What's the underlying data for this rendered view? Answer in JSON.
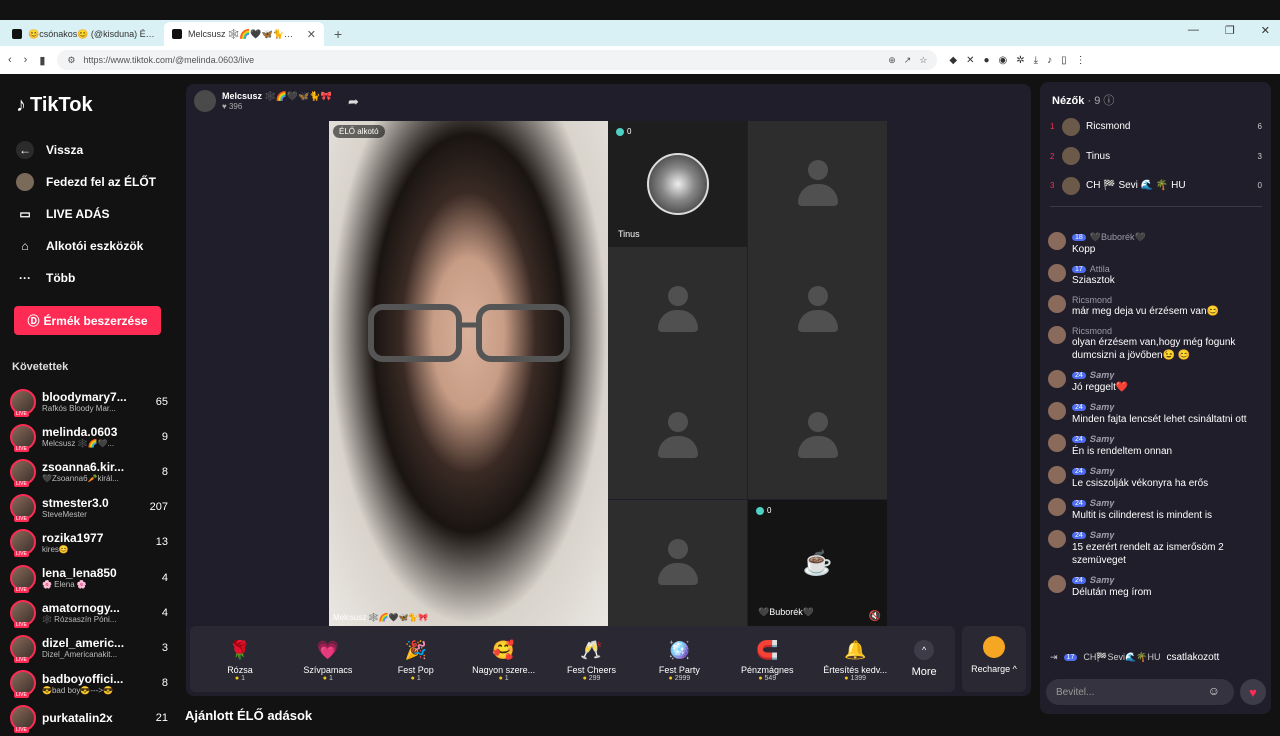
{
  "browser": {
    "tabs": [
      {
        "title": "😊csónakos😊 (@kisduna) ÉLŐ adá",
        "active": false
      },
      {
        "title": "Melcsusz 🕸️🌈🖤🦋🐈🎀 (@",
        "active": true
      }
    ],
    "url": "https://www.tiktok.com/@melinda.0603/live"
  },
  "sidebar": {
    "logo": "TikTok",
    "nav": [
      {
        "label": "Vissza",
        "icon": "back-arrow-icon"
      },
      {
        "label": "Fedezd fel az ÉLŐT",
        "icon": "explore-avatar-icon"
      },
      {
        "label": "LIVE ADÁS",
        "icon": "camera-icon"
      },
      {
        "label": "Alkotói eszközök",
        "icon": "house-icon"
      },
      {
        "label": "Több",
        "icon": "dots-icon"
      }
    ],
    "coin_button": "Érmék beszerzése",
    "following_title": "Követettek",
    "following": [
      {
        "name": "bloodymary7...",
        "sub": "Rafkós Bloody Mar...",
        "count": "65"
      },
      {
        "name": "melinda.0603",
        "sub": "Melcsusz 🕸️🌈🖤...",
        "count": "9"
      },
      {
        "name": "zsoanna6.kir...",
        "sub": "🖤Zsoanna6🥕királ...",
        "count": "8"
      },
      {
        "name": "stmester3.0",
        "sub": "SteveMester",
        "count": "207"
      },
      {
        "name": "rozika1977",
        "sub": "kires😊",
        "count": "13"
      },
      {
        "name": "lena_lena850",
        "sub": "🌸 Elena 🌸",
        "count": "4"
      },
      {
        "name": "amatornogy...",
        "sub": "🕸️ Rózsaszín Póni...",
        "count": "4"
      },
      {
        "name": "dizel_americ...",
        "sub": "Dizel_Americanakit...",
        "count": "3"
      },
      {
        "name": "badboyoffici...",
        "sub": "😎bad boy😎--->😎",
        "count": "8"
      },
      {
        "name": "purkatalin2x",
        "sub": "",
        "count": "21"
      }
    ]
  },
  "live": {
    "host_name": "Melcsusz 🕸️🌈🖤🦋🐈🎀",
    "host_likes": "♥ 396",
    "main_badge": "ÉLŐ alkotó",
    "main_caption": "Melcsusz 🕸️🌈🖤🦋🐈🎀",
    "guest1_name": "Tinus",
    "guest1_count": "0",
    "guest2_name": "🖤Buborék🖤",
    "guest2_count": "0"
  },
  "gifts": [
    {
      "name": "Rózsa",
      "price": "1",
      "icon": "🌹"
    },
    {
      "name": "Szívpamacs",
      "price": "1",
      "icon": "💗"
    },
    {
      "name": "Fest Pop",
      "price": "1",
      "icon": "🎉"
    },
    {
      "name": "Nagyon szere...",
      "price": "1",
      "icon": "🥰"
    },
    {
      "name": "Fest Cheers",
      "price": "299",
      "icon": "🥂"
    },
    {
      "name": "Fest Party",
      "price": "2999",
      "icon": "🪩"
    },
    {
      "name": "Pénzmágnes",
      "price": "549",
      "icon": "🧲"
    },
    {
      "name": "Értesítés kedv...",
      "price": "1399",
      "icon": "🔔"
    }
  ],
  "more_label": "More",
  "recharge_label": "Recharge ^",
  "recommended_title": "Ajánlott ÉLŐ adások",
  "chat": {
    "viewers_title": "Nézők",
    "viewers_count": "· 9",
    "viewers": [
      {
        "rank": "1",
        "name": "Ricsmond",
        "score": "6"
      },
      {
        "rank": "2",
        "name": "Tinus",
        "score": "3"
      },
      {
        "rank": "3",
        "name": "CH 🏁 Sevi 🌊 🌴 HU",
        "score": "0"
      }
    ],
    "messages": [
      {
        "level": "18",
        "user": "🖤Buborék🖤",
        "text": "Kopp"
      },
      {
        "level": "17",
        "user": "Attila",
        "text": "Sziasztok"
      },
      {
        "level": "",
        "user": "Ricsmond",
        "text": "már meg deja vu érzésem van😊"
      },
      {
        "level": "",
        "user": "Ricsmond",
        "text": "olyan érzésem van,hogy még fogunk dumcsizni a jövőben😉 😊"
      },
      {
        "level": "24",
        "user": "𝑺𝒂𝒎𝒚",
        "text": "Jó reggelt❤️"
      },
      {
        "level": "24",
        "user": "𝑺𝒂𝒎𝒚",
        "text": "Minden fajta lencsét lehet csináltatni ott"
      },
      {
        "level": "24",
        "user": "𝑺𝒂𝒎𝒚",
        "text": "Én is rendeltem onnan"
      },
      {
        "level": "24",
        "user": "𝑺𝒂𝒎𝒚",
        "text": "Le csiszolják vékonyra ha erős"
      },
      {
        "level": "24",
        "user": "𝑺𝒂𝒎𝒚",
        "text": "Multit is cilinderest is mindent is"
      },
      {
        "level": "24",
        "user": "𝑺𝒂𝒎𝒚",
        "text": "15 ezerért rendelt az ismerősöm 2 szemüveget"
      },
      {
        "level": "24",
        "user": "𝑺𝒂𝒎𝒚",
        "text": "Délután meg írom"
      }
    ],
    "join_level": "17",
    "join_user": "CH🏁Sevi🌊🌴HU",
    "join_text": "csatlakozott",
    "input_placeholder": "Bevitel..."
  }
}
